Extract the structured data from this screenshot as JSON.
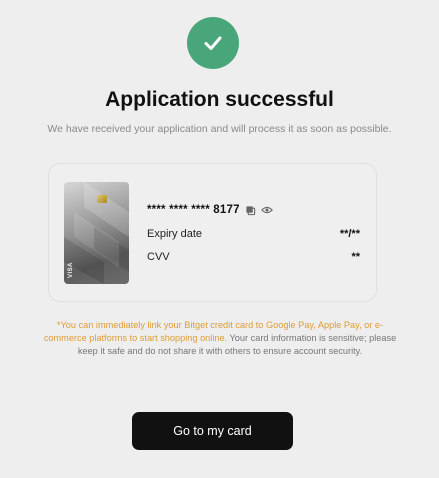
{
  "header": {
    "title": "Application successful",
    "subtitle": "We have received your application and will process it as soon as possible."
  },
  "card": {
    "brand": "VISA",
    "number": "**** **** **** 8177",
    "expiry_label": "Expiry date",
    "expiry_value": "**/**",
    "cvv_label": "CVV",
    "cvv_value": "**"
  },
  "notice": {
    "highlight": "*You can immediately link your Bitget credit card to Google Pay, Apple Pay, or e-commerce platforms to start shopping online.",
    "body": " Your card information is sensitive; please keep it safe and do not share it with others to ensure account security."
  },
  "actions": {
    "go_to_card_label": "Go to my card"
  },
  "colors": {
    "success": "#49a67a",
    "highlight": "#dd9c34",
    "button": "#111111"
  }
}
